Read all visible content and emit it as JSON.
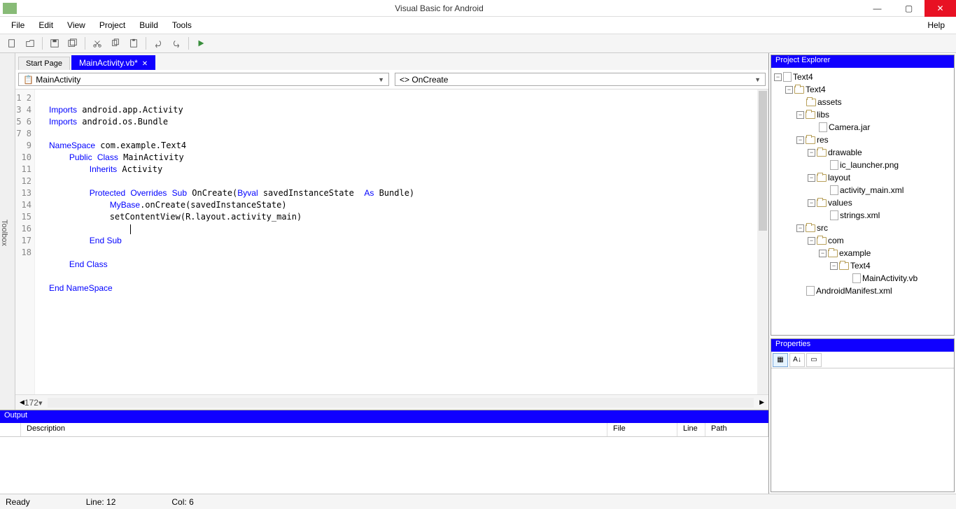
{
  "window": {
    "title": "Visual Basic for Android"
  },
  "menu": {
    "file": "File",
    "edit": "Edit",
    "view": "View",
    "project": "Project",
    "build": "Build",
    "tools": "Tools",
    "help": "Help"
  },
  "tabs": {
    "start": "Start Page",
    "active": "MainActivity.vb*"
  },
  "combos": {
    "class": "MainActivity",
    "method": "OnCreate"
  },
  "code": {
    "lines": [
      "1",
      "2",
      "3",
      "4",
      "5",
      "6",
      "7",
      "8",
      "9",
      "10",
      "11",
      "12",
      "13",
      "14",
      "15",
      "16",
      "17",
      "18"
    ]
  },
  "zoom": "172",
  "output": {
    "title": "Output",
    "cols": {
      "desc": "Description",
      "file": "File",
      "line": "Line",
      "path": "Path"
    }
  },
  "explorer": {
    "title": "Project Explorer",
    "root": "Text4",
    "proj": "Text4",
    "assets": "assets",
    "libs": "libs",
    "camera": "Camera.jar",
    "res": "res",
    "drawable": "drawable",
    "launcher": "ic_launcher.png",
    "layout": "layout",
    "actmain": "activity_main.xml",
    "values": "values",
    "strings": "strings.xml",
    "src": "src",
    "com": "com",
    "example": "example",
    "text4": "Text4",
    "mainact": "MainActivity.vb",
    "manifest": "AndroidManifest.xml"
  },
  "props": {
    "title": "Properties"
  },
  "status": {
    "ready": "Ready",
    "line": "Line: 12",
    "col": "Col: 6"
  },
  "toolbox": "Toolbox"
}
